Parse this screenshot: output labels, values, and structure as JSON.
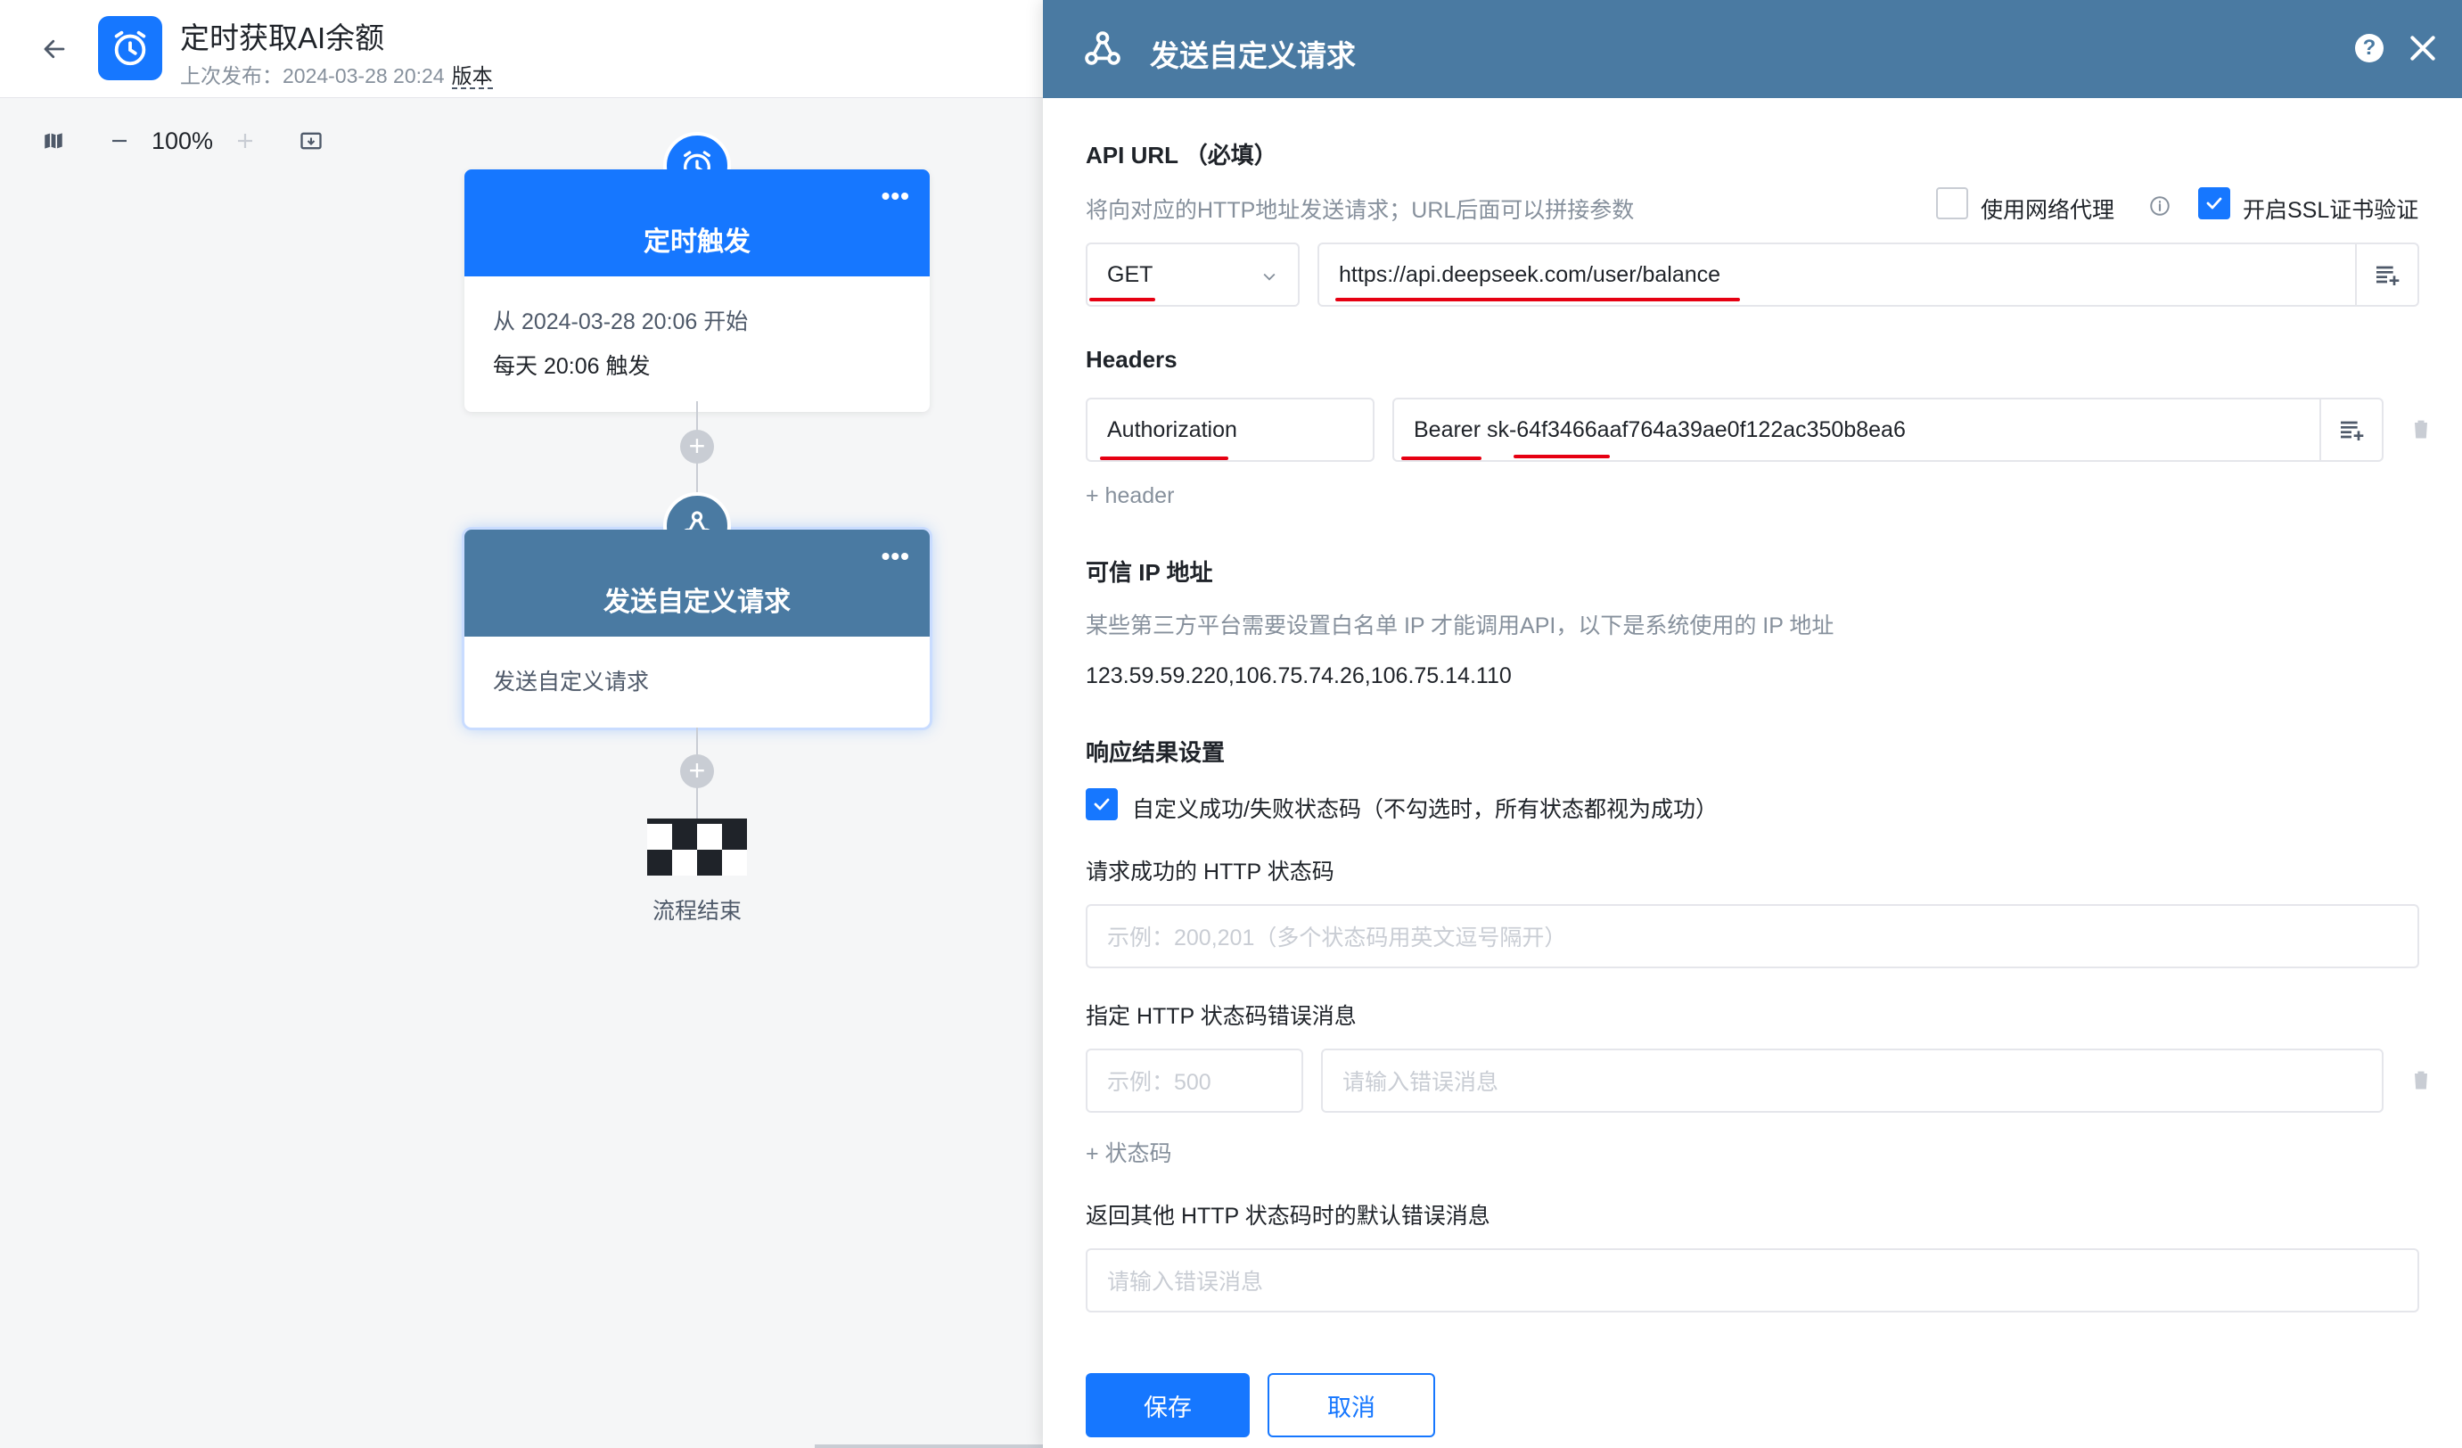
{
  "app": {
    "title": "定时获取AI余额",
    "publish_prefix": "上次发布：",
    "publish_time": "2024-03-28 20:24",
    "version_label": "版本"
  },
  "zoom": {
    "value": "100%"
  },
  "nodes": {
    "trigger": {
      "title": "定时触发",
      "line1": "从 2024-03-28 20:06 开始",
      "line2": "每天 20:06 触发"
    },
    "request": {
      "title": "发送自定义请求",
      "desc": "发送自定义请求"
    },
    "end": {
      "label": "流程结束"
    }
  },
  "drawer": {
    "title": "发送自定义请求",
    "api_url": {
      "label": "API URL （必填）",
      "hint": "将向对应的HTTP地址发送请求；URL后面可以拼接参数",
      "proxy_label": "使用网络代理",
      "proxy_checked": false,
      "ssl_label": "开启SSL证书验证",
      "ssl_checked": true,
      "method": "GET",
      "url": "https://api.deepseek.com/user/balance"
    },
    "headers": {
      "label": "Headers",
      "key": "Authorization",
      "value": "Bearer sk-64f3466aaf764a39ae0f122ac350b8ea6",
      "add_label": "+ header"
    },
    "trusted_ip": {
      "label": "可信 IP 地址",
      "hint": "某些第三方平台需要设置白名单 IP 才能调用API，以下是系统使用的 IP 地址",
      "value": "123.59.59.220,106.75.74.26,106.75.14.110"
    },
    "response": {
      "label": "响应结果设置",
      "custom_status_label": "自定义成功/失败状态码（不勾选时，所有状态都视为成功）",
      "custom_status_checked": true,
      "success_code_label": "请求成功的 HTTP 状态码",
      "success_code_placeholder": "示例：200,201（多个状态码用英文逗号隔开）",
      "error_msg_label": "指定 HTTP 状态码错误消息",
      "error_code_placeholder": "示例：500",
      "error_msg_placeholder": "请输入错误消息",
      "add_status_label": "+ 状态码",
      "default_error_label": "返回其他 HTTP 状态码时的默认错误消息",
      "default_error_placeholder": "请输入错误消息"
    },
    "footer": {
      "save_label": "保存",
      "cancel_label": "取消"
    }
  },
  "colors": {
    "primary": "#1677ff",
    "node_request": "#4a7aa2",
    "annotation_red": "#e60012"
  },
  "icons": [
    "back-arrow-icon",
    "alarm-clock-icon",
    "map-icon",
    "zoom-out-icon",
    "zoom-in-icon",
    "fit-screen-icon",
    "more-dots-icon",
    "webhook-icon",
    "add-node-icon",
    "checkered-flag-icon",
    "help-icon",
    "close-icon",
    "chevron-down-icon",
    "text-insert-icon",
    "trash-icon",
    "info-icon",
    "checkmark-icon"
  ]
}
